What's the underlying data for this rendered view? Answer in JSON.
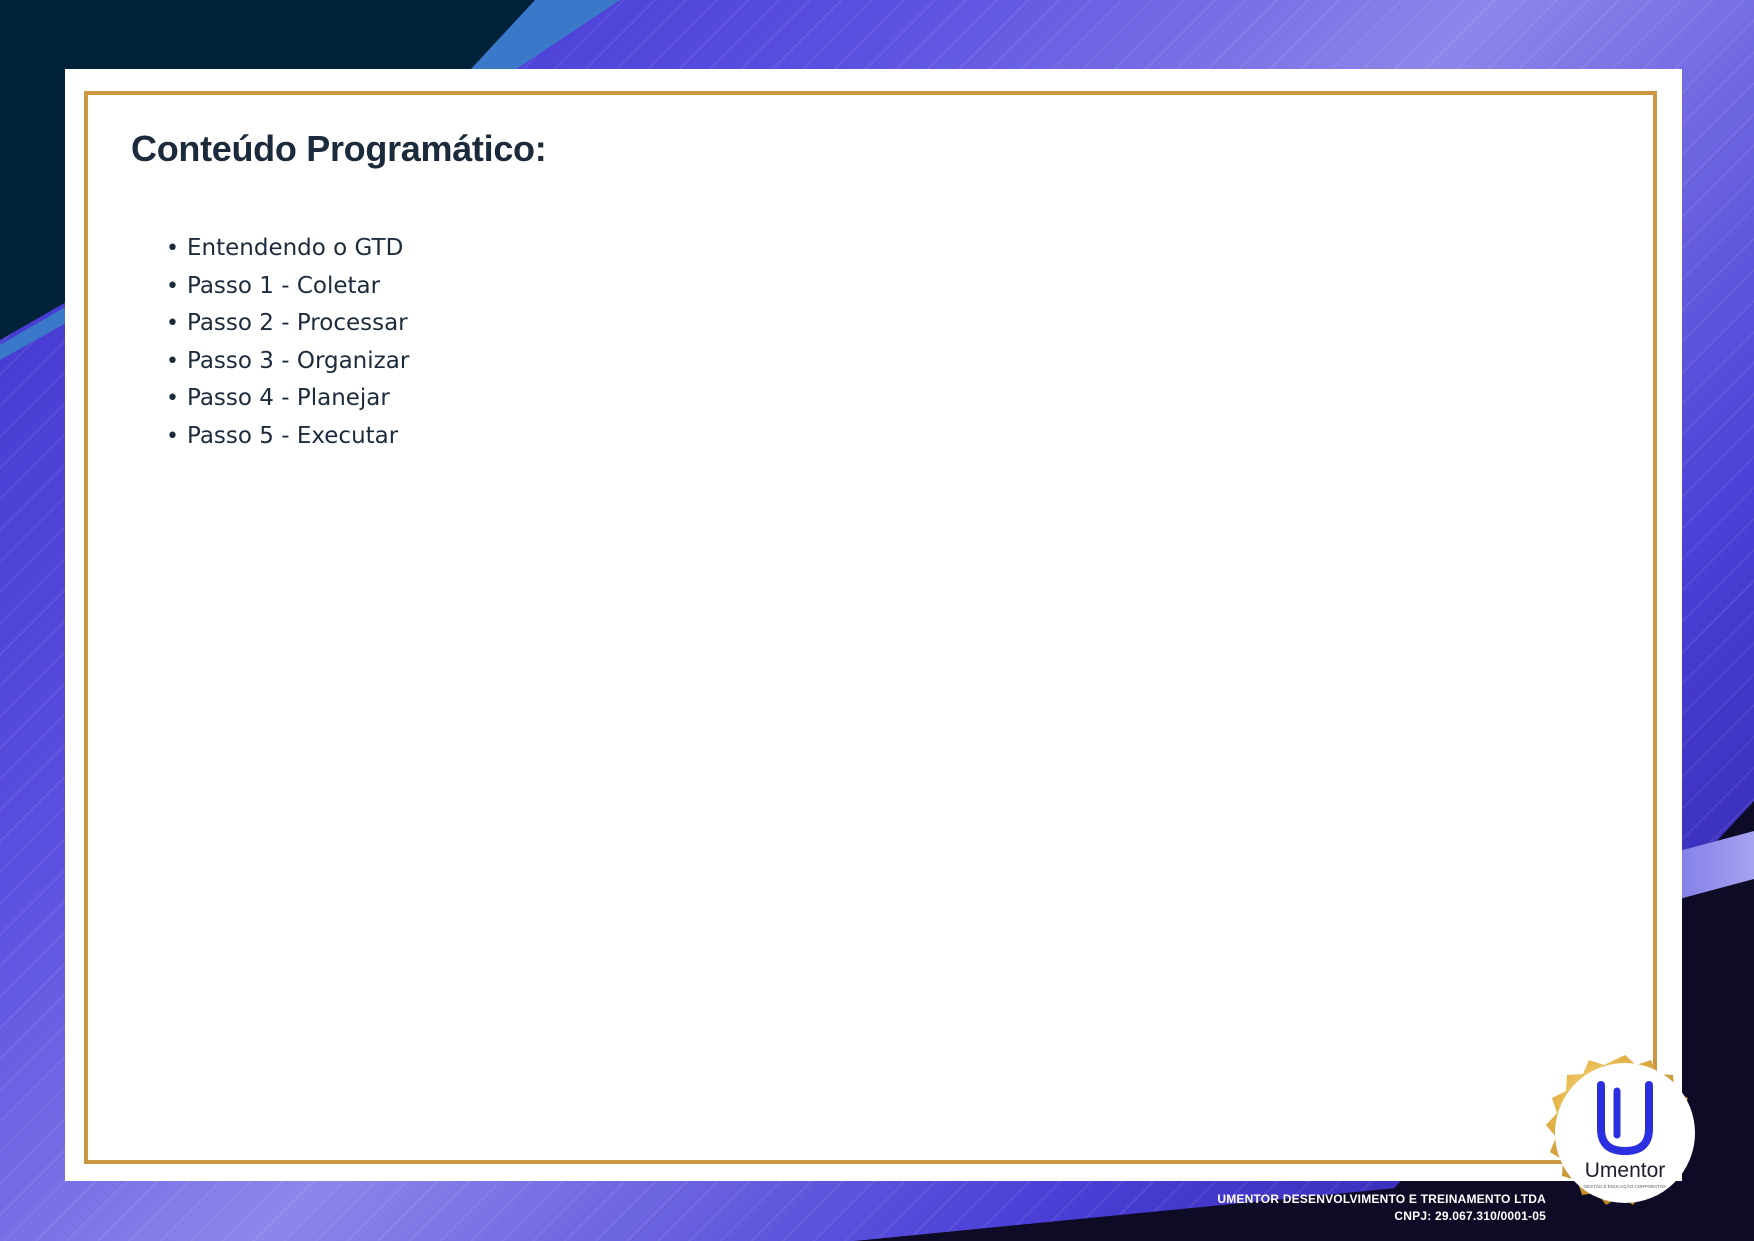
{
  "document": {
    "title": "Conteúdo Programático:",
    "topics": [
      "Entendendo o GTD",
      "Passo 1 - Coletar",
      "Passo 2 - Processar",
      "Passo 3 - Organizar",
      "Passo 4 - Planejar",
      "Passo 5 - Executar"
    ]
  },
  "footer": {
    "company": "UMENTOR DESENVOLVIMENTO E TREINAMENTO LTDA",
    "cnpj": "CNPJ: 29.067.310/0001-05"
  },
  "logo": {
    "name": "Umentor",
    "tagline": "GESTÃO E EDUCAÇÃO CORPORATIVA"
  },
  "colors": {
    "frame": "#cf9641",
    "text": "#1c2b3c",
    "logo_blue": "#2b2fe0",
    "seal_gold": "#e0b04a"
  }
}
